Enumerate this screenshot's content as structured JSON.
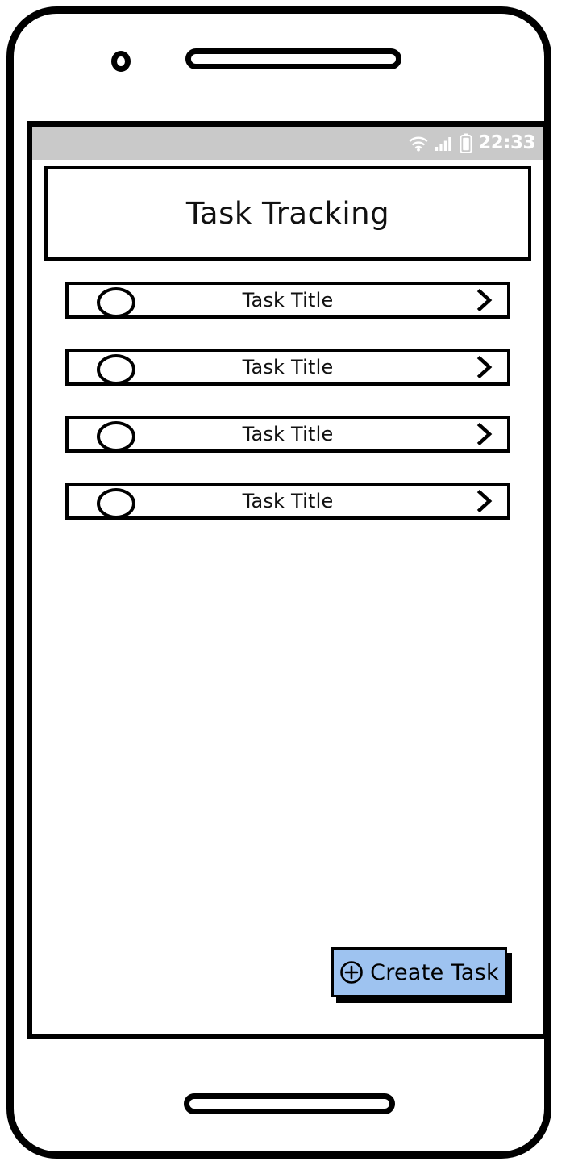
{
  "device": {
    "name": "smartphone-mockup",
    "camera_icon": "camera-dot-icon",
    "speaker_icon": "speaker-grille-icon",
    "home_icon": "home-button-icon"
  },
  "status_bar": {
    "time": "22:33",
    "background_color": "#c9c9c9",
    "foreground_color": "#ffffff",
    "icons": [
      {
        "name": "wifi-icon",
        "label": "wifi"
      },
      {
        "name": "signal-bars-icon",
        "label": "cellular signal"
      },
      {
        "name": "battery-icon",
        "label": "battery"
      }
    ]
  },
  "app": {
    "title": "Task Tracking"
  },
  "task_list": {
    "items": [
      {
        "title": "Task Title",
        "checked": false
      },
      {
        "title": "Task Title",
        "checked": false
      },
      {
        "title": "Task Title",
        "checked": false
      },
      {
        "title": "Task Title",
        "checked": false
      }
    ],
    "checkbox_icon": "circle-checkbox-icon",
    "disclosure_icon": "chevron-right-icon"
  },
  "create_button": {
    "label": "Create Task",
    "icon": "plus-circle-icon",
    "background_color": "#9ec3f0",
    "border_color": "#000000",
    "text_color": "#000000"
  }
}
